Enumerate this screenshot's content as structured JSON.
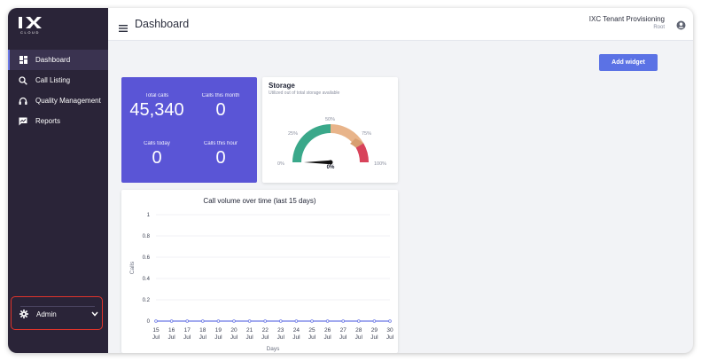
{
  "brand": {
    "logo_text": "IX",
    "logo_sub": "CLOUD"
  },
  "sidebar": {
    "items": [
      {
        "label": "Dashboard",
        "icon": "dashboard-icon",
        "active": true
      },
      {
        "label": "Call Listing",
        "icon": "search-icon",
        "active": false
      },
      {
        "label": "Quality Management",
        "icon": "headset-icon",
        "active": false
      },
      {
        "label": "Reports",
        "icon": "reports-icon",
        "active": false
      }
    ],
    "admin": {
      "label": "Admin",
      "icon": "gear-icon"
    }
  },
  "header": {
    "title": "Dashboard",
    "tenant_name": "IXC Tenant Provisioning",
    "tenant_role": "Root"
  },
  "actions": {
    "add_widget": "Add widget"
  },
  "stats": {
    "total_calls_label": "Total calls",
    "total_calls_value": "45,340",
    "calls_month_label": "Calls this month",
    "calls_month_value": "0",
    "calls_today_label": "Calls today",
    "calls_today_value": "0",
    "calls_hour_label": "Calls this hour",
    "calls_hour_value": "0"
  },
  "storage": {
    "title": "Storage",
    "subtitle": "Utilized out of total storage available",
    "value_percent": 0,
    "value_label": "0%",
    "ticks": [
      "0%",
      "25%",
      "50%",
      "75%",
      "100%"
    ],
    "colors": {
      "green": "#3aa88a",
      "orange": "#e8b48a",
      "red": "#d8435a"
    }
  },
  "chart_data": {
    "type": "line",
    "title": "Call volume over time (last 15 days)",
    "xlabel": "Days",
    "ylabel": "Calls",
    "ylim": [
      0,
      1
    ],
    "yticks": [
      "0",
      "0.2",
      "0.4",
      "0.6",
      "0.8",
      "1"
    ],
    "categories": [
      "15 Jul",
      "16 Jul",
      "17 Jul",
      "18 Jul",
      "19 Jul",
      "20 Jul",
      "21 Jul",
      "22 Jul",
      "23 Jul",
      "24 Jul",
      "25 Jul",
      "26 Jul",
      "27 Jul",
      "28 Jul",
      "29 Jul",
      "30 Jul"
    ],
    "series": [
      {
        "values": [
          0,
          0,
          0,
          0,
          0,
          0,
          0,
          0,
          0,
          0,
          0,
          0,
          0,
          0,
          0,
          0
        ],
        "color": "#6b78e5"
      }
    ],
    "grid": true
  },
  "colors": {
    "sidebar": "#2a2438",
    "accent": "#5b72e5",
    "stats_card": "#5a55d6",
    "highlight": "#e0342b"
  }
}
